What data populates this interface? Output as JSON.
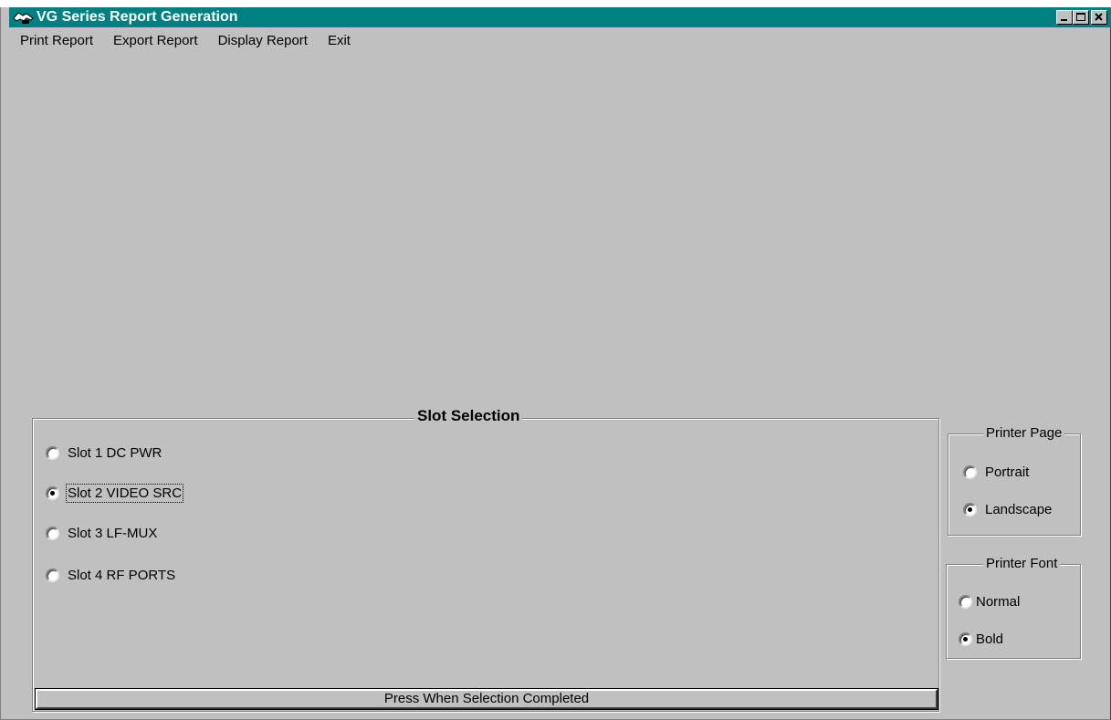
{
  "window": {
    "title": "VG Series Report Generation",
    "title_bar_color": "#008080",
    "controls": [
      "minimize-icon",
      "maximize-icon",
      "close-icon"
    ]
  },
  "menu": {
    "items": [
      "Print Report",
      "Export Report",
      "Display Report",
      "Exit"
    ]
  },
  "slot_selection": {
    "title": "Slot Selection",
    "options": [
      {
        "label": "Slot 1 DC PWR",
        "selected": false
      },
      {
        "label": "Slot 2 VIDEO SRC",
        "selected": true
      },
      {
        "label": "Slot 3 LF-MUX",
        "selected": false
      },
      {
        "label": "Slot 4 RF PORTS",
        "selected": false
      }
    ],
    "submit_label": "Press When Selection Completed"
  },
  "printer_page": {
    "title": "Printer Page",
    "options": [
      {
        "label": "Portrait",
        "selected": false
      },
      {
        "label": "Landscape",
        "selected": true
      }
    ]
  },
  "printer_font": {
    "title": "Printer Font",
    "options": [
      {
        "label": "Normal",
        "selected": false
      },
      {
        "label": "Bold",
        "selected": true
      }
    ]
  }
}
